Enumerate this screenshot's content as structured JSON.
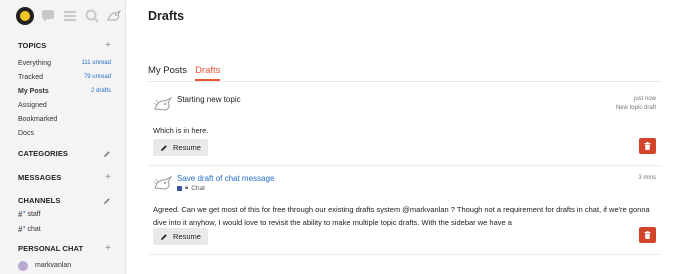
{
  "sidebar": {
    "topics_header": "TOPICS",
    "topics": [
      {
        "label": "Everything",
        "badge": "111 unread"
      },
      {
        "label": "Tracked",
        "badge": "79 unread"
      },
      {
        "label": "My Posts",
        "badge": "2 drafts"
      },
      {
        "label": "Assigned",
        "badge": ""
      },
      {
        "label": "Bookmarked",
        "badge": ""
      },
      {
        "label": "Docs",
        "badge": ""
      }
    ],
    "categories_header": "CATEGORIES",
    "messages_header": "MESSAGES",
    "channels_header": "CHANNELS",
    "channels": [
      {
        "label": "staff"
      },
      {
        "label": "chat"
      }
    ],
    "personal_chat_header": "PERSONAL CHAT",
    "personal_chat_user": "markvanlan"
  },
  "page": {
    "title": "Drafts",
    "tabs": [
      "My Posts",
      "Drafts"
    ],
    "active_tab": "Drafts"
  },
  "drafts": [
    {
      "title": "Starting new topic",
      "time": "just now",
      "kind": "New topic draft",
      "body": "Which is in here.",
      "resume_label": "Resume"
    },
    {
      "title": "Save draft of chat message",
      "time": "3 mins",
      "category": "Chat",
      "body_line1": "Agreed. Can we get most of this for free through our existing drafts system @markvanlan ? Though not a requirement for drafts in chat, if we're gonna",
      "body_line2": "dive into it anyhow, I would love to revisit the ability to make multiple topic drafts. With the sidebar we have a",
      "resume_label": "Resume"
    }
  ],
  "colors": {
    "accent": "#e45735",
    "link": "#2570c9",
    "delete": "#d2452b"
  },
  "icons": [
    "logo-icon",
    "chat-bubble-icon",
    "hamburger-icon",
    "search-icon",
    "dragon-avatar-icon",
    "pencil-icon",
    "trash-icon",
    "plus-icon",
    "lock-icon"
  ]
}
